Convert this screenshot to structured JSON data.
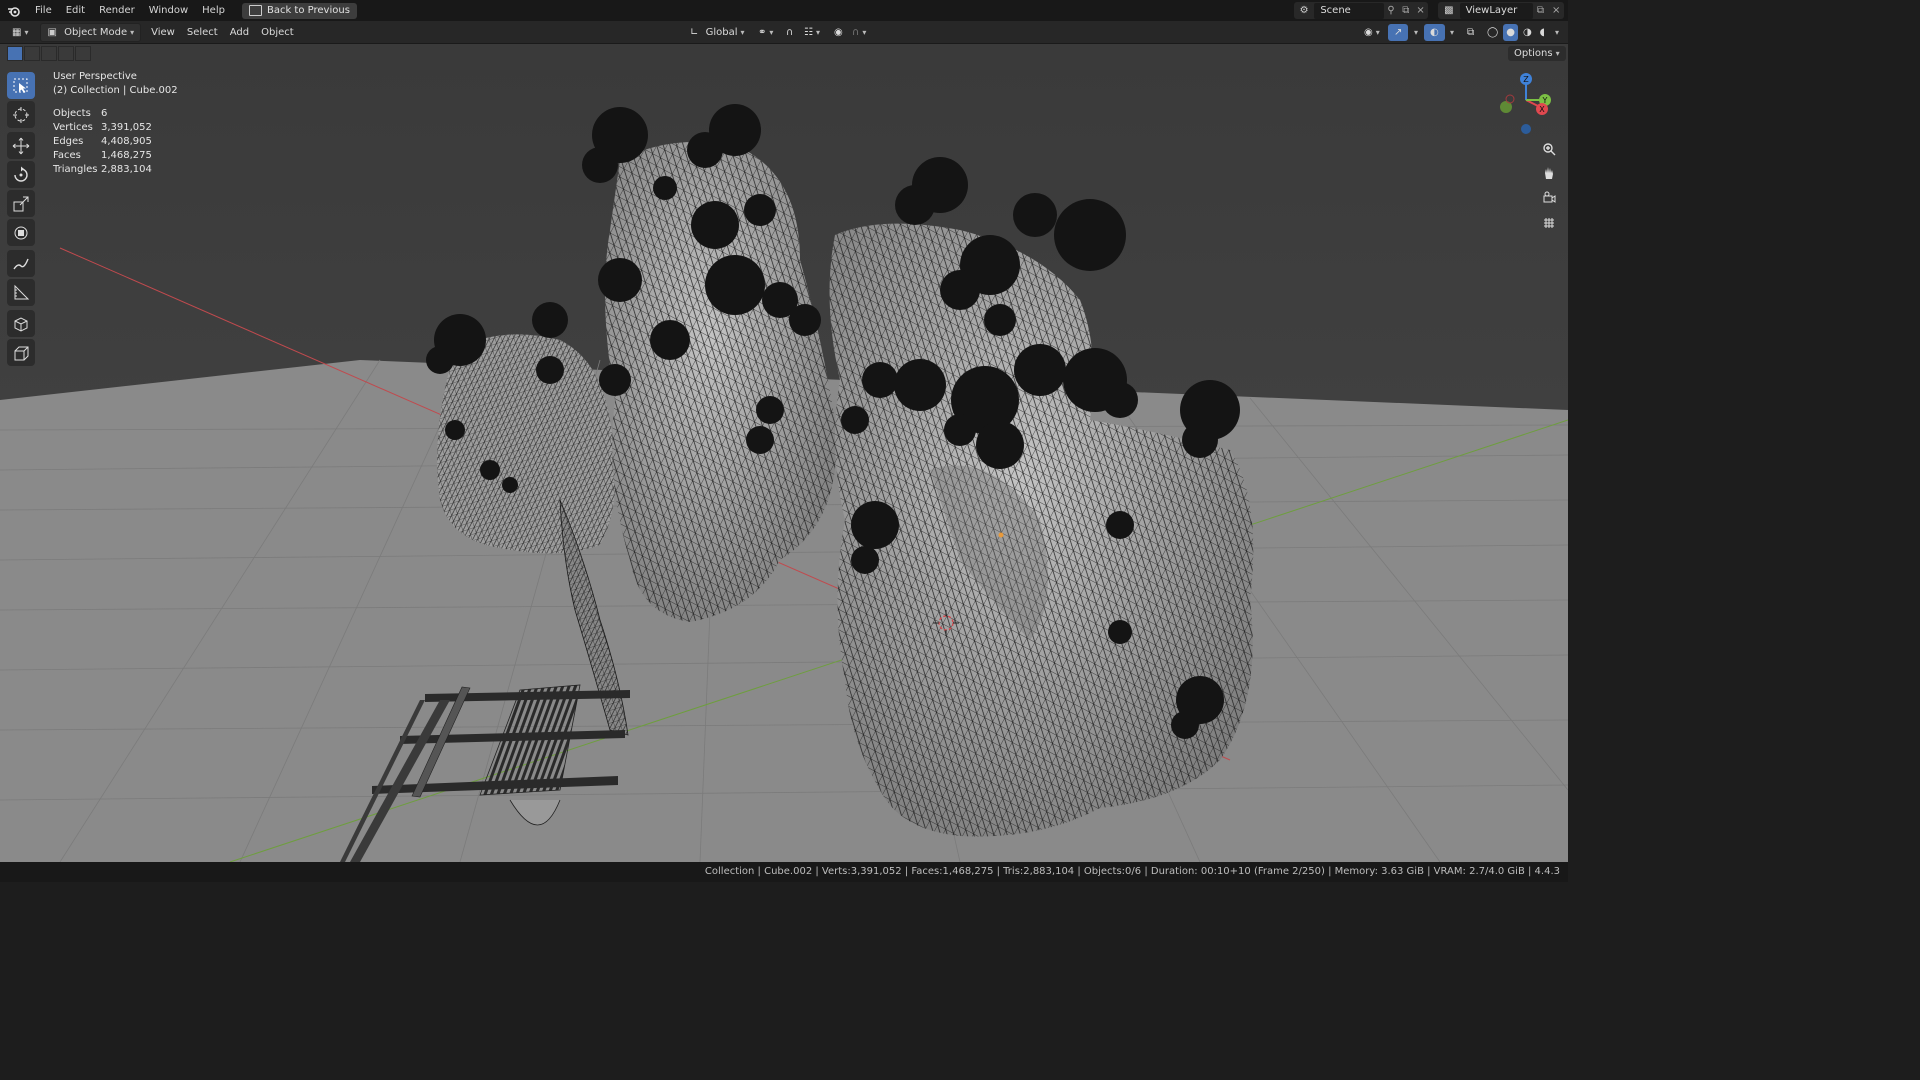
{
  "menubar": {
    "items": [
      "File",
      "Edit",
      "Render",
      "Window",
      "Help"
    ],
    "back_button": "Back to Previous",
    "scene": "Scene",
    "view_layer": "ViewLayer"
  },
  "header": {
    "mode": "Object Mode",
    "menus": [
      "View",
      "Select",
      "Add",
      "Object"
    ],
    "transform_orientation": "Global",
    "options": "Options"
  },
  "viewport": {
    "perspective": "User Perspective",
    "collection": "(2) Collection | Cube.002",
    "stats": [
      {
        "label": "Objects",
        "value": "6"
      },
      {
        "label": "Vertices",
        "value": "3,391,052"
      },
      {
        "label": "Edges",
        "value": "4,408,905"
      },
      {
        "label": "Faces",
        "value": "1,468,275"
      },
      {
        "label": "Triangles",
        "value": "2,883,104"
      }
    ],
    "gizmo_axes": [
      "Z",
      "Y",
      "X"
    ]
  },
  "toolbar": {
    "tools": [
      "select-box",
      "cursor",
      "move",
      "rotate",
      "scale",
      "transform",
      "annotate",
      "measure",
      "add-cube",
      "extrude"
    ]
  },
  "statusbar": {
    "text": "Collection | Cube.002 | Verts:3,391,052 | Faces:1,468,275 | Tris:2,883,104 | Objects:0/6 | Duration: 00:10+10 (Frame 2/250) | Memory: 3.63 GiB | VRAM: 2.7/4.0 GiB | 4.4.3"
  },
  "colors": {
    "accent": "#4772b3",
    "axis_x": "#e0484f",
    "axis_y": "#7bc044",
    "axis_z": "#3f82d9",
    "viewport_bg": "#3e3e3e"
  }
}
